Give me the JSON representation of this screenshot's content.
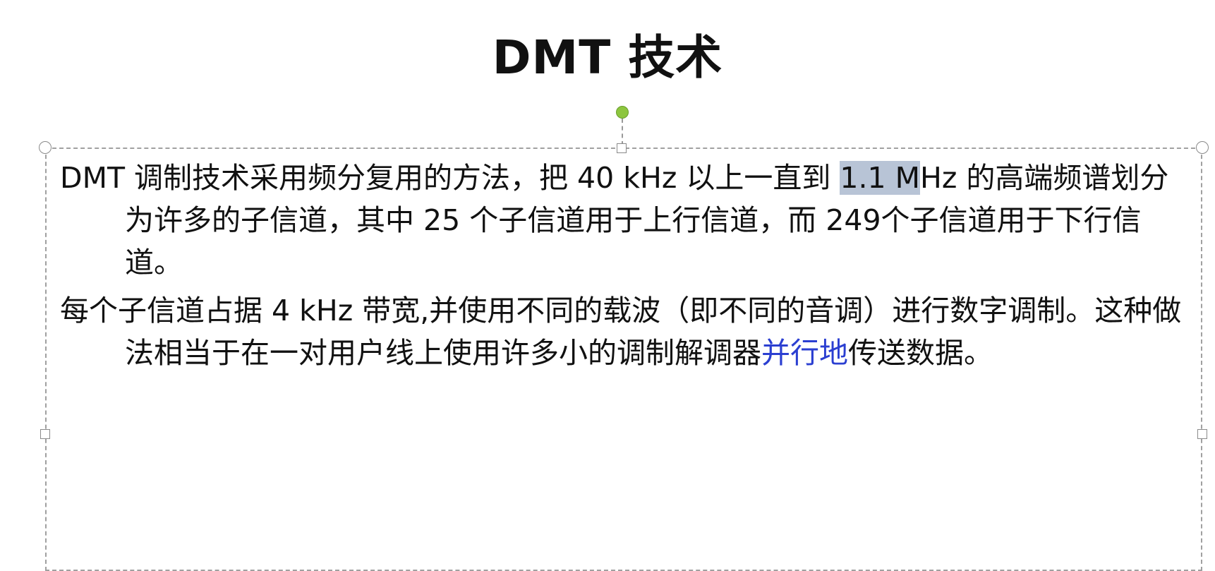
{
  "slide": {
    "title": "DMT 技术"
  },
  "textbox": {
    "paragraph1": {
      "part1": "DMT 调制技术采用频分复用的方法，把 40 kHz 以上一直到 ",
      "highlight": "1.1 M",
      "part2": "Hz 的高端频谱划分为许多的子信道，其中 25 个子信道用于上行信道，而 249个子信道用于下行信道。"
    },
    "paragraph2": {
      "part1": "每个子信道占据 4 kHz 带宽,并使用不同的载波（即不同的音调）进行数字调制。这种做法相当于在一对用户线上使用许多小的调制解调器",
      "blue": "并行地",
      "part2": "传送数据。"
    }
  },
  "colors": {
    "selection_highlight": "#b8c4d6",
    "link_text": "#2b3fd1",
    "rotate_handle": "#8dc63f",
    "border": "#a0a0a0"
  }
}
